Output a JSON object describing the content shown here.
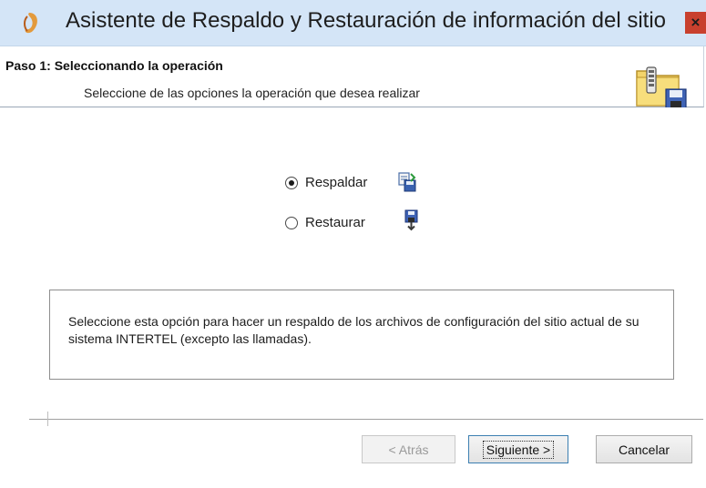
{
  "window": {
    "title": "Asistente de Respaldo y Restauración de información del sitio",
    "close_label": "×"
  },
  "header": {
    "step_title": "Paso 1: Seleccionando la operación",
    "step_subtitle": "Seleccione de las opciones la operación que desea realizar",
    "icon": "backup-folder-disk-icon"
  },
  "options": [
    {
      "label": "Respaldar",
      "checked": true,
      "icon": "backup-files-icon"
    },
    {
      "label": "Restaurar",
      "checked": false,
      "icon": "restore-disk-icon"
    }
  ],
  "description": "Seleccione esta opción para hacer un respaldo de los archivos de configuración del sitio actual de su sistema INTERTEL (excepto las llamadas).",
  "buttons": {
    "back": "< Atrás",
    "next": "Siguiente >",
    "cancel": "Cancelar"
  },
  "colors": {
    "titlebar": "#d4e5f7",
    "close": "#c8402e",
    "default_button_border": "#3c7fb1"
  }
}
